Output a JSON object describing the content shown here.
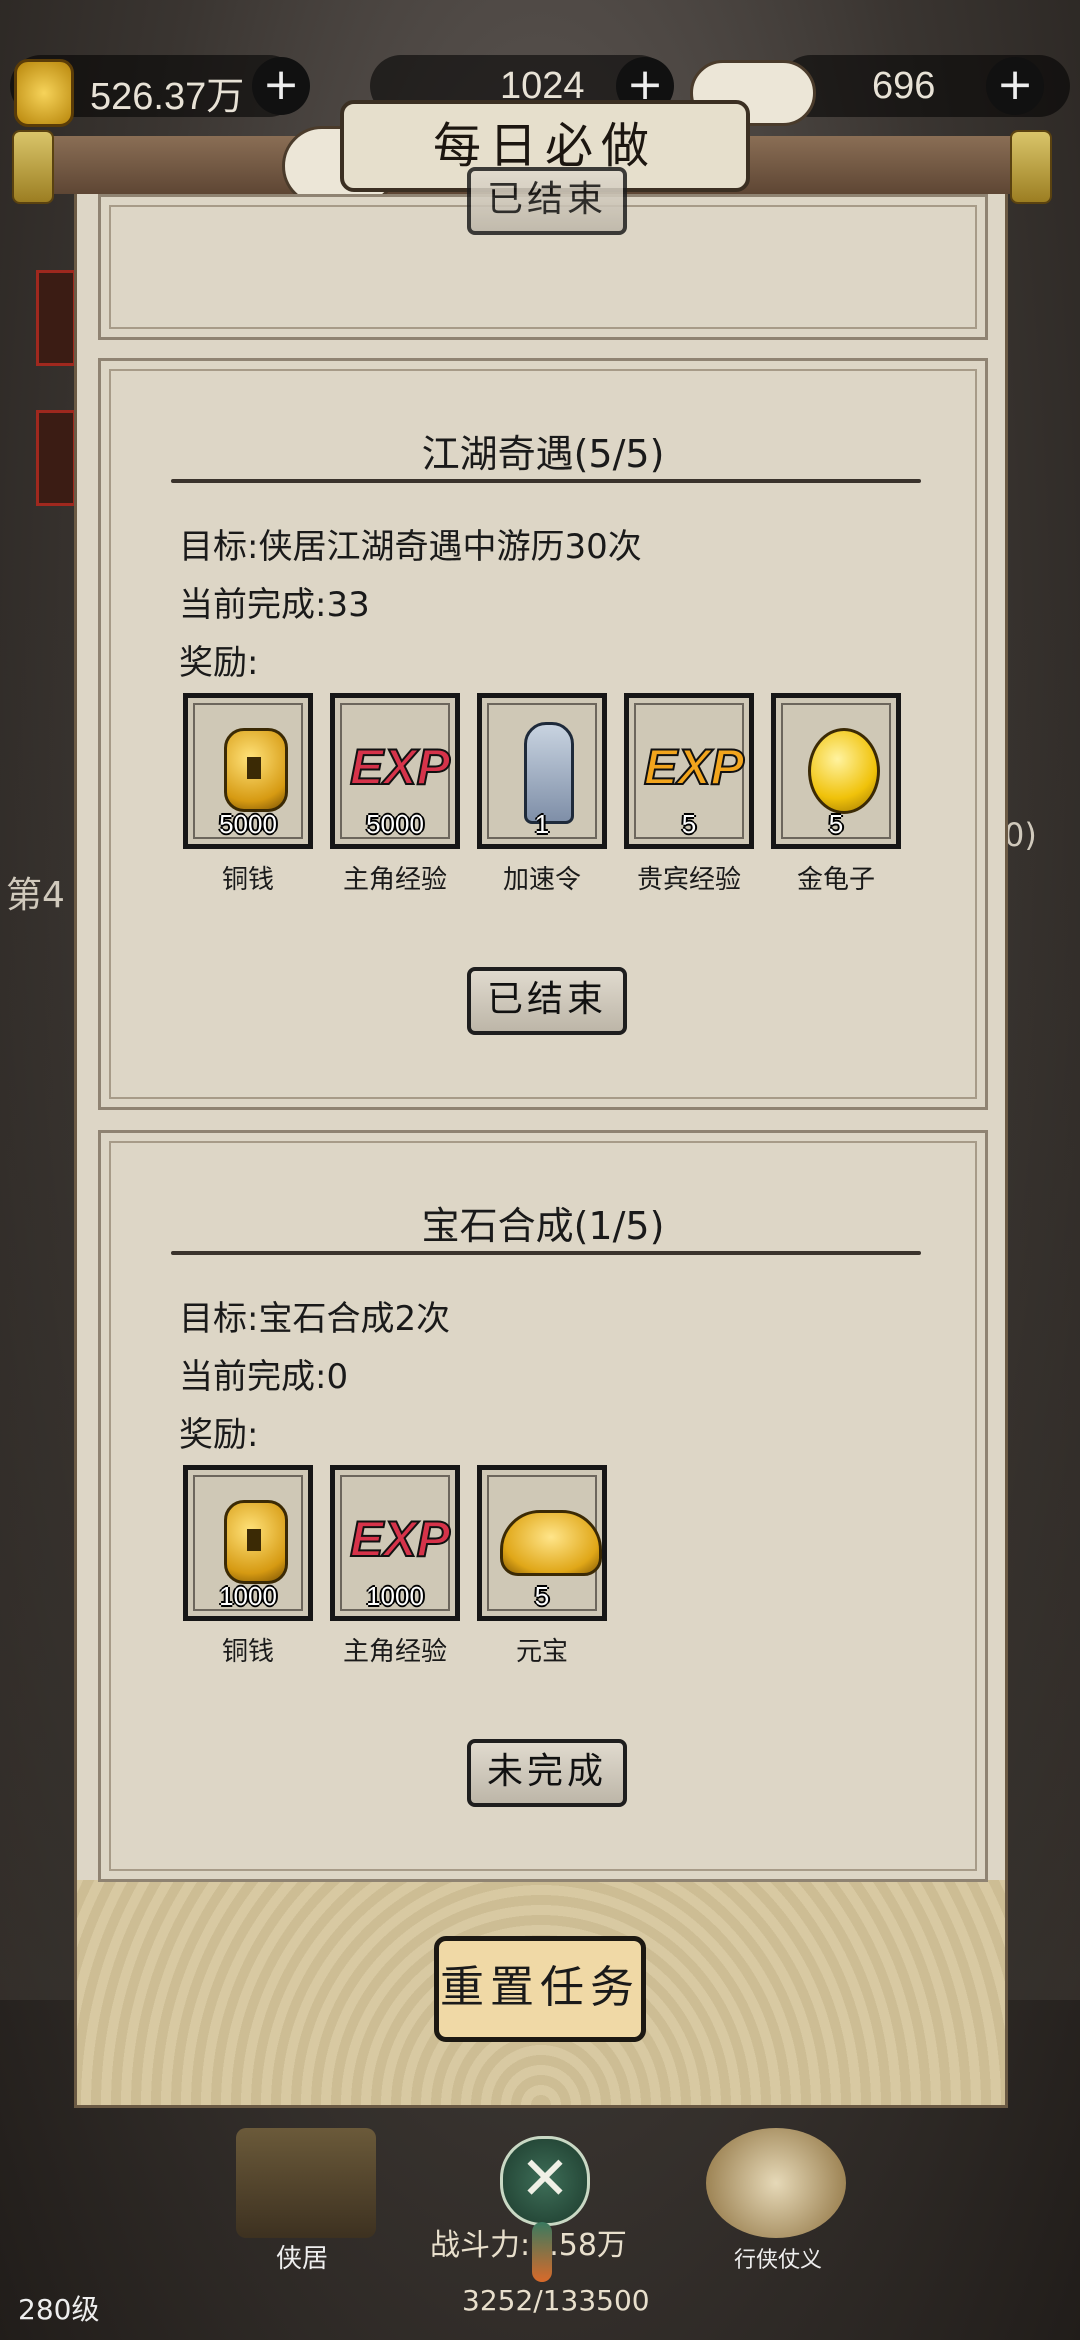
{
  "topbar": {
    "coins": "526.37万",
    "middle": "1024",
    "gems": "696",
    "plus": "+"
  },
  "header": {
    "title": "每日必做"
  },
  "prev_card": {
    "button_label": "已结束"
  },
  "tasks": [
    {
      "title": "江湖奇遇(5/5)",
      "goal": "目标:侠居江湖奇遇中游历30次",
      "progress": "当前完成:33",
      "reward_label": "奖励:",
      "rewards": [
        {
          "name": "铜钱",
          "qty": "5000",
          "icon": "copper-coin-icon"
        },
        {
          "name": "主角经验",
          "qty": "5000",
          "icon": "exp-red-icon"
        },
        {
          "name": "加速令",
          "qty": "1",
          "icon": "speed-token-icon"
        },
        {
          "name": "贵宾经验",
          "qty": "5",
          "icon": "exp-gold-icon"
        },
        {
          "name": "金龟子",
          "qty": "5",
          "icon": "golden-beetle-icon"
        }
      ],
      "button_label": "已结束"
    },
    {
      "title": "宝石合成(1/5)",
      "goal": "目标:宝石合成2次",
      "progress": "当前完成:0",
      "reward_label": "奖励:",
      "rewards": [
        {
          "name": "铜钱",
          "qty": "1000",
          "icon": "copper-coin-icon"
        },
        {
          "name": "主角经验",
          "qty": "1000",
          "icon": "exp-red-icon"
        },
        {
          "name": "元宝",
          "qty": "5",
          "icon": "gold-ingot-icon"
        }
      ],
      "button_label": "未完成"
    }
  ],
  "reset_button": "重置任务",
  "bottom": {
    "level": "280级",
    "home": "侠居",
    "power": "战斗力:8.58万",
    "exp": "3252/133500",
    "quest": "行侠仗义",
    "side_left": "第4",
    "side_right": "0)"
  },
  "colors": {
    "exp_red": "#d6334a",
    "exp_gold": "#f2a51d",
    "panel": "#ddd6c6",
    "reset_button": "#f0d9a6"
  }
}
